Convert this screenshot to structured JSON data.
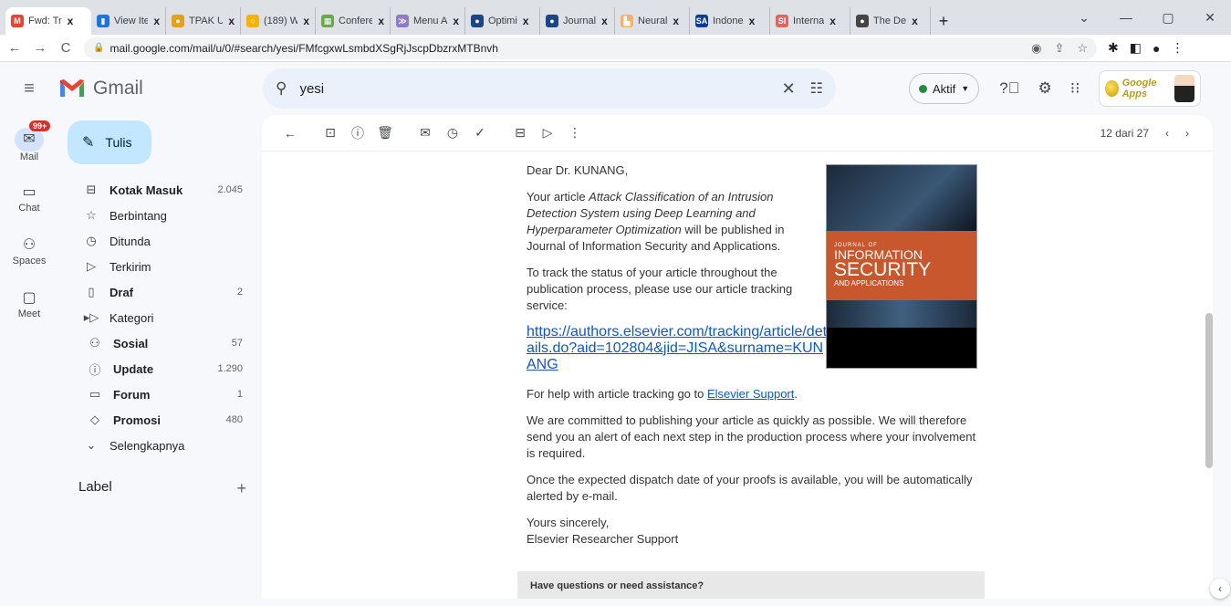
{
  "browser": {
    "tabs": [
      {
        "label": "Fwd: Tr",
        "icon_color": "#ea4335",
        "icon_glyph": "M",
        "active": true
      },
      {
        "label": "View Ite",
        "icon_color": "#1a73e8",
        "icon_glyph": "▮"
      },
      {
        "label": "TPAK U",
        "icon_color": "#e3a21a",
        "icon_glyph": "●"
      },
      {
        "label": "(189) W",
        "icon_color": "#f4b400",
        "icon_glyph": "○"
      },
      {
        "label": "Confere",
        "icon_color": "#6aa84f",
        "icon_glyph": "▦"
      },
      {
        "label": "Menu A",
        "icon_color": "#8e7cc3",
        "icon_glyph": "≫"
      },
      {
        "label": "Optimi",
        "icon_color": "#1c4587",
        "icon_glyph": "●"
      },
      {
        "label": "Journal",
        "icon_color": "#1c4587",
        "icon_glyph": "●"
      },
      {
        "label": "Neural",
        "icon_color": "#f6b26b",
        "icon_glyph": "▙"
      },
      {
        "label": "Indone",
        "icon_color": "#0b3d91",
        "icon_glyph": "SA"
      },
      {
        "label": "Interna",
        "icon_color": "#e06666",
        "icon_glyph": "SI"
      },
      {
        "label": "The De",
        "icon_color": "#444444",
        "icon_glyph": "●"
      }
    ],
    "tab_close": "x",
    "new_tab": "+",
    "window_controls": [
      "⌄",
      "—",
      "▢",
      "✕"
    ],
    "url": "mail.google.com/mail/u/0/#search/yesi/FMfcgxwLsmbdXSgRjJscpDbzrxMTBnvh"
  },
  "gmail": {
    "logo_text": "Gmail",
    "search_value": "yesi",
    "status_label": "Aktif",
    "org_label": "Google Apps",
    "rail": [
      {
        "label": "Mail",
        "icon": "mail-icon",
        "badge": "99+"
      },
      {
        "label": "Chat",
        "icon": "chat-icon"
      },
      {
        "label": "Spaces",
        "icon": "spaces-icon"
      },
      {
        "label": "Meet",
        "icon": "meet-icon"
      }
    ],
    "compose_label": "Tulis",
    "nav": [
      {
        "label": "Kotak Masuk",
        "count": "2.045",
        "icon": "inbox-icon",
        "bold": true
      },
      {
        "label": "Berbintang",
        "count": "",
        "icon": "star-icon"
      },
      {
        "label": "Ditunda",
        "count": "",
        "icon": "clock-icon"
      },
      {
        "label": "Terkirim",
        "count": "",
        "icon": "send-icon"
      },
      {
        "label": "Draf",
        "count": "2",
        "icon": "draft-icon",
        "bold": true
      },
      {
        "label": "Kategori",
        "count": "",
        "icon": "label-icon"
      },
      {
        "label": "Sosial",
        "count": "57",
        "icon": "people-icon",
        "bold": true,
        "sub": true
      },
      {
        "label": "Update",
        "count": "1.290",
        "icon": "info-icon",
        "bold": true,
        "sub": true
      },
      {
        "label": "Forum",
        "count": "1",
        "icon": "forum-icon",
        "bold": true,
        "sub": true
      },
      {
        "label": "Promosi",
        "count": "480",
        "icon": "tag-icon",
        "bold": true,
        "sub": true
      },
      {
        "label": "Selengkapnya",
        "count": "",
        "icon": "chevron-down-icon"
      }
    ],
    "label_heading": "Label",
    "pager_text": "12 dari 27"
  },
  "email": {
    "greeting": "Dear Dr. KUNANG,",
    "p1_prefix": "Your article ",
    "p1_title": "Attack Classification of an Intrusion Detection System using Deep Learning and Hyperparameter Optimization",
    "p1_suffix": " will be published in Journal of Information Security and Applications.",
    "p2": "To track the status of your article throughout the publication process, please use our article tracking service:",
    "tracking_link": "https://authors.elsevier.com/tracking/article/details.do?aid=102804&jid=JISA&surname=KUNANG",
    "p3_prefix": "For help with article tracking go to ",
    "p3_link": "Elsevier Support",
    "p3_suffix": ".",
    "p4": "We are committed to publishing your article as quickly as possible. We will therefore send you an alert of each next step in the production process where your involvement is required.",
    "p5": "Once the expected dispatch date of your proofs is available, you will be automatically alerted by e-mail.",
    "closing": "Yours sincerely,",
    "signature": "Elsevier Researcher Support",
    "assist_heading": "Have questions or need assistance?",
    "cover": {
      "line1": "INFORMATION",
      "line2": "SECURITY",
      "line3": "AND APPLICATIONS",
      "small": "JOURNAL OF"
    }
  }
}
